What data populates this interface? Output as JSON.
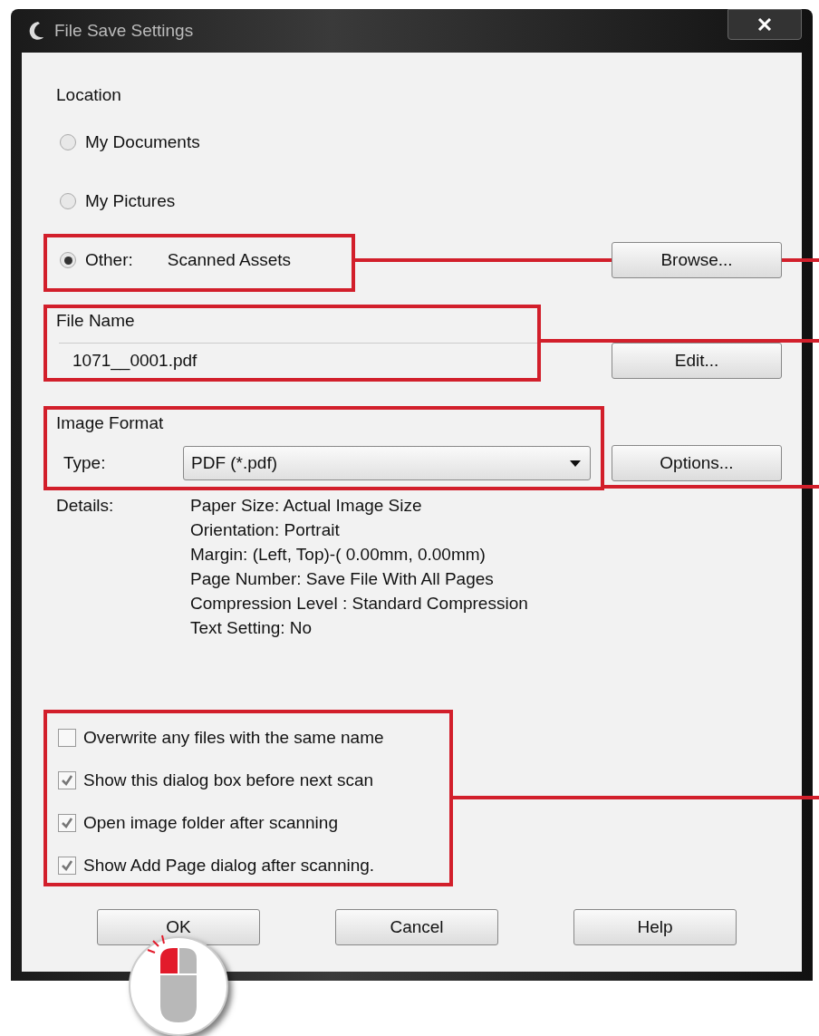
{
  "window": {
    "title": "File Save Settings"
  },
  "location": {
    "label": "Location",
    "options": [
      {
        "label": "My Documents",
        "selected": false
      },
      {
        "label": "My Pictures",
        "selected": false
      },
      {
        "label": "Other:",
        "selected": true,
        "value": "Scanned Assets"
      }
    ],
    "browse_button": "Browse..."
  },
  "file_name": {
    "label": "File Name",
    "value": "1071__0001.pdf",
    "edit_button": "Edit..."
  },
  "image_format": {
    "label": "Image Format",
    "type_label": "Type:",
    "type_value": "PDF (*.pdf)",
    "options_button": "Options..."
  },
  "details": {
    "label": "Details:",
    "lines": [
      "Paper Size: Actual Image Size",
      "Orientation: Portrait",
      "Margin: (Left, Top)-( 0.00mm, 0.00mm)",
      "Page Number: Save File With All Pages",
      "Compression Level : Standard Compression",
      "Text Setting: No"
    ]
  },
  "checkboxes": [
    {
      "label": "Overwrite any files with the same name",
      "checked": false
    },
    {
      "label": "Show this dialog box before next scan",
      "checked": true
    },
    {
      "label": "Open image folder after scanning",
      "checked": true
    },
    {
      "label": "Show Add Page dialog after scanning.",
      "checked": true
    }
  ],
  "buttons": [
    "OK",
    "Cancel",
    "Help"
  ]
}
